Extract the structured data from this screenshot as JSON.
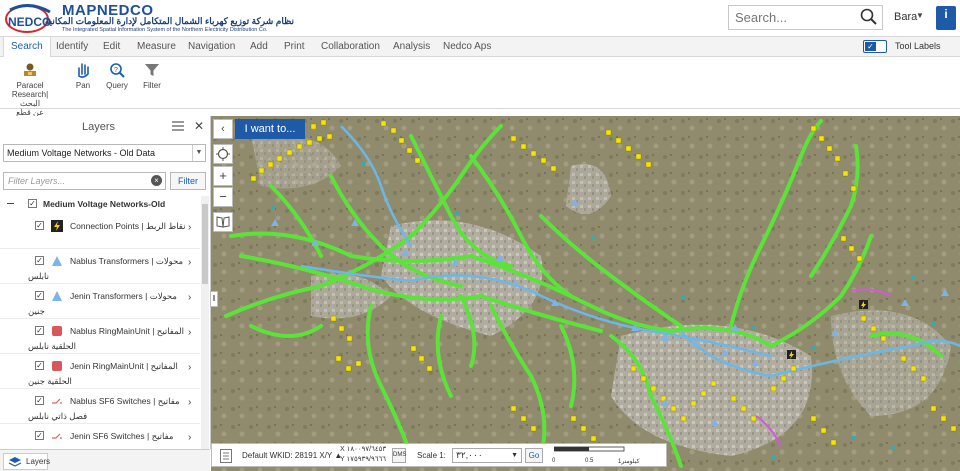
{
  "header": {
    "brand": "MAPNEDCO",
    "arabic_title": "نظام شركة توزيع كهرباء الشمال المتكامل لإدارة المعلومات المكانية",
    "english_title": "The Integrated Spatial Information System of the Northern Electricity Distribution Co.",
    "search_placeholder": "Search...",
    "user": "Bara"
  },
  "tabs": [
    "Search",
    "Identify",
    "Edit",
    "Measure",
    "Navigation",
    "Add",
    "Print",
    "Collaboration",
    "Analysis",
    "Nedco Aps"
  ],
  "active_tab": "Search",
  "tool_labels": "Tool Labels",
  "ribbon": {
    "parcel_research": [
      "Paracel",
      "Research|البحث",
      "عن قطع الاراضي"
    ],
    "pan": "Pan",
    "query": "Query",
    "filter": "Filter"
  },
  "layers_panel": {
    "title": "Layers",
    "selected_layer_set": "Medium Voltage Networks - Old Data",
    "filter_placeholder": "Filter Layers...",
    "filter_button": "Filter",
    "group_label": "Medium Voltage Networks-Old",
    "layers": [
      {
        "line1": "Connection Points | نقاط الربط",
        "line2": ""
      },
      {
        "line1": "Nablus Transformers | محولات",
        "line2": "نابلس"
      },
      {
        "line1": "Jenin Transformers | محولات",
        "line2": "جنين"
      },
      {
        "line1": "Nablus RingMainUnit | المفاتيح",
        "line2": "الحلقية نابلس"
      },
      {
        "line1": "Jenin RingMainUnit | المفاتيح",
        "line2": "الحلقية جنين"
      },
      {
        "line1": "Nablus SF6 Switches | مفاتيح",
        "line2": "فصل ذاتي نابلس"
      },
      {
        "line1": "Jenin SF6 Switches | مفاتيح",
        "line2": ""
      }
    ],
    "bottom_tab": "Layers"
  },
  "map": {
    "i_want_to": "I want to...",
    "default_wkid": "Default WKID: 28191 X/Y ▲",
    "x_coord": "X ١٨٠٠٩٧/٦٤٥٣",
    "y_coord": "Y ١٧٥٩٣٩/٩٦٦٦",
    "scale_label": "Scale 1:",
    "scale_value": "٣٢,٠٠٠",
    "go": "Go",
    "scale_bar_labels": [
      "0",
      "0.5",
      "1كيلومتر"
    ]
  },
  "colors": {
    "brand_blue": "#1f5aa8",
    "green_network": "#5be33a",
    "yellow_points": "#f2e40c",
    "blue_transformers": "#7db3e8"
  }
}
